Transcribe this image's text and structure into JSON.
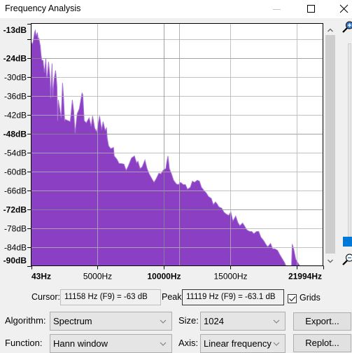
{
  "window": {
    "title": "Frequency Analysis"
  },
  "chart_data": {
    "type": "area",
    "title": "",
    "xlabel": "",
    "ylabel": "",
    "x_unit": "Hz",
    "y_unit": "dB",
    "xlim": [
      43,
      21994
    ],
    "ylim": [
      -90,
      -13
    ],
    "grid": true,
    "legend": "none",
    "fill_color": "#8b3fc3",
    "edge_color": "#a872d8",
    "cursor_hz": 11158,
    "peak": {
      "hz": 11119,
      "db": -63.1
    },
    "x_ticks": [
      {
        "value": 43,
        "label": "43Hz",
        "major": true
      },
      {
        "value": 5000,
        "label": "5000Hz",
        "major": false
      },
      {
        "value": 10000,
        "label": "10000Hz",
        "major": true
      },
      {
        "value": 15000,
        "label": "15000Hz",
        "major": false
      },
      {
        "value": 20000,
        "label": "",
        "major": false
      },
      {
        "value": 21994,
        "label": "21994Hz",
        "major": true
      }
    ],
    "y_ticks": [
      {
        "value": -13,
        "label": "-13dB",
        "major": true
      },
      {
        "value": -18,
        "label": "",
        "major": false
      },
      {
        "value": -24,
        "label": "-24dB",
        "major": true
      },
      {
        "value": -30,
        "label": "-30dB",
        "major": false
      },
      {
        "value": -36,
        "label": "-36dB",
        "major": false
      },
      {
        "value": -42,
        "label": "-42dB",
        "major": false
      },
      {
        "value": -48,
        "label": "-48dB",
        "major": true
      },
      {
        "value": -54,
        "label": "-54dB",
        "major": false
      },
      {
        "value": -60,
        "label": "-60dB",
        "major": false
      },
      {
        "value": -66,
        "label": "-66dB",
        "major": false
      },
      {
        "value": -72,
        "label": "-72dB",
        "major": true
      },
      {
        "value": -78,
        "label": "-78dB",
        "major": false
      },
      {
        "value": -84,
        "label": "-84dB",
        "major": false
      },
      {
        "value": -90,
        "label": "-90dB",
        "major": true
      }
    ],
    "series": [
      {
        "name": "Spectrum",
        "x": [
          43,
          148,
          201,
          306,
          358,
          411,
          516,
          568,
          621,
          726,
          778,
          831,
          936,
          988,
          1041,
          1146,
          1198,
          1251,
          1356,
          1461,
          1513,
          1566,
          1618,
          1671,
          1723,
          1776,
          1881,
          1933,
          1986,
          2038,
          2091,
          2196,
          2301,
          2406,
          2458,
          2563,
          2616,
          2826,
          2984,
          3141,
          3246,
          3351,
          3509,
          3666,
          3876,
          3929,
          4034,
          4191,
          4401,
          4559,
          4664,
          4821,
          4979,
          5189,
          5347,
          5452,
          5609,
          5714,
          5767,
          5872,
          6029,
          6239,
          6292,
          6502,
          6659,
          6817,
          7027,
          7184,
          7342,
          7552,
          7604,
          7814,
          7972,
          8077,
          8234,
          8392,
          8602,
          8760,
          8917,
          9127,
          9285,
          9442,
          9652,
          9810,
          9967,
          10177,
          10230,
          10335,
          10440,
          10598,
          10755,
          10965,
          11123,
          11280,
          11490,
          11648,
          11805,
          12015,
          12173,
          12330,
          12540,
          12698,
          12855,
          13065,
          13223,
          13380,
          13590,
          13748,
          13905,
          14010,
          14168,
          14378,
          14536,
          14693,
          14903,
          15061,
          15218,
          15428,
          15586,
          15743,
          15953,
          16111,
          16268,
          16478,
          16636,
          16793,
          17003,
          17161,
          17318,
          17528,
          17686,
          17843,
          18053,
          18211,
          18368,
          18578,
          18736,
          18893,
          19103,
          19208,
          19629,
          19681,
          19786,
          19944,
          20154,
          20259,
          21994
        ],
        "values": [
          -19.0,
          -19.5,
          -18.6,
          -15.7,
          -15.2,
          -17.0,
          -15.9,
          -18.1,
          -17.7,
          -20.1,
          -22.6,
          -24.6,
          -24.8,
          -26.8,
          -28.6,
          -24.1,
          -29.7,
          -30.1,
          -25.2,
          -30.1,
          -36.8,
          -30.8,
          -25.7,
          -36.4,
          -33.0,
          -30.6,
          -27.9,
          -30.1,
          -33.0,
          -43.9,
          -37.3,
          -40.1,
          -43.0,
          -31.9,
          -35.0,
          -43.9,
          -43.5,
          -43.9,
          -44.2,
          -37.3,
          -40.8,
          -47.9,
          -41.7,
          -40.1,
          -35.0,
          -35.7,
          -43.9,
          -44.6,
          -43.0,
          -45.7,
          -42.4,
          -46.2,
          -47.5,
          -42.4,
          -46.8,
          -44.2,
          -47.0,
          -46.2,
          -49.5,
          -51.9,
          -52.8,
          -52.4,
          -55.1,
          -56.2,
          -57.5,
          -57.5,
          -57.7,
          -59.7,
          -58.4,
          -56.2,
          -55.7,
          -55.1,
          -57.3,
          -56.8,
          -59.1,
          -58.6,
          -56.4,
          -59.1,
          -60.8,
          -62.4,
          -63.5,
          -62.4,
          -60.6,
          -60.8,
          -59.7,
          -59.1,
          -57.5,
          -55.1,
          -59.1,
          -60.8,
          -62.8,
          -64.0,
          -64.2,
          -63.5,
          -64.2,
          -64.2,
          -65.7,
          -65.1,
          -63.1,
          -63.5,
          -62.8,
          -63.1,
          -65.1,
          -66.2,
          -66.9,
          -68.0,
          -68.6,
          -70.6,
          -69.7,
          -70.2,
          -71.3,
          -71.7,
          -72.9,
          -73.5,
          -74.0,
          -72.9,
          -75.8,
          -74.2,
          -76.2,
          -77.3,
          -76.4,
          -77.5,
          -78.6,
          -79.1,
          -79.1,
          -79.8,
          -79.1,
          -79.1,
          -80.9,
          -82.0,
          -83.1,
          -84.0,
          -82.9,
          -84.6,
          -84.6,
          -85.1,
          -86.4,
          -87.5,
          -89.0,
          -90,
          -90,
          -83.1,
          -84.6,
          -87.9,
          -89.4,
          -90,
          -90
        ]
      }
    ]
  },
  "readouts": {
    "cursor_label": "Cursor:",
    "cursor_value": "11158 Hz (F9) = -63 dB",
    "peak_label": "Peak:",
    "peak_value": "11119 Hz (F9) = -63.1 dB",
    "grids_label": "Grids",
    "grids_checked": true
  },
  "controls": {
    "algorithm": {
      "label": "Algorithm:",
      "value": "Spectrum"
    },
    "size": {
      "label": "Size:",
      "value": "1024"
    },
    "function": {
      "label": "Function:",
      "value": "Hann window"
    },
    "axis": {
      "label": "Axis:",
      "value": "Linear frequency"
    },
    "export_label": "Export...",
    "replot_label": "Replot..."
  },
  "scrollbar": {
    "visible_fraction": 1.0,
    "position": 0.0
  },
  "vertical_zoom": {
    "slider_fraction": 0.0
  }
}
